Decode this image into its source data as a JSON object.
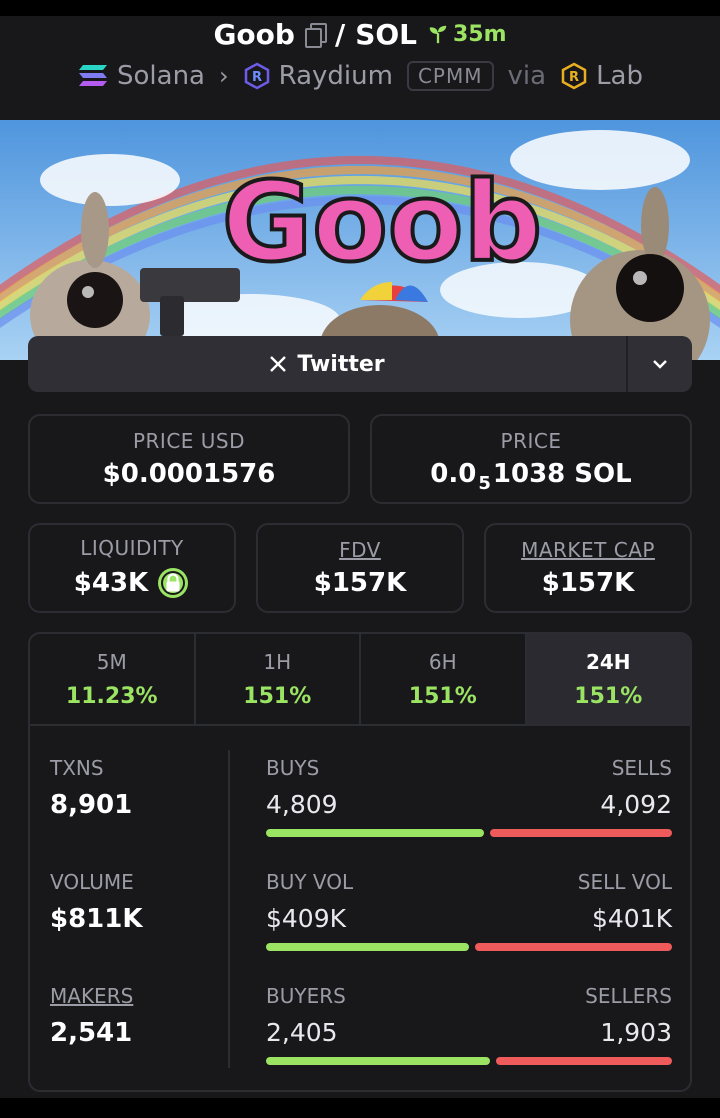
{
  "header": {
    "token": "Goob",
    "separator": "/",
    "quote": "SOL",
    "age": "35m",
    "chain": "Solana",
    "dex": "Raydium",
    "pool_type": "CPMM",
    "via": "via",
    "launchpad": "Lab"
  },
  "banner": {
    "text": "Goob"
  },
  "links": {
    "twitter_label": "Twitter"
  },
  "price": {
    "usd_label": "PRICE USD",
    "usd_value": "$0.0001576",
    "native_label": "PRICE",
    "native_prefix": "0.0",
    "native_zeros": "5",
    "native_digits": "1038 SOL"
  },
  "metrics": {
    "liquidity_label": "LIQUIDITY",
    "liquidity_value": "$43K",
    "fdv_label": "FDV",
    "fdv_value": "$157K",
    "mcap_label": "MARKET CAP",
    "mcap_value": "$157K"
  },
  "timeframes": [
    {
      "label": "5M",
      "change": "11.23%"
    },
    {
      "label": "1H",
      "change": "151%"
    },
    {
      "label": "6H",
      "change": "151%"
    },
    {
      "label": "24H",
      "change": "151%"
    }
  ],
  "stats": {
    "txns_label": "TXNS",
    "txns_value": "8,901",
    "buys_label": "BUYS",
    "buys_value": "4,809",
    "sells_label": "SELLS",
    "sells_value": "4,092",
    "volume_label": "VOLUME",
    "volume_value": "$811K",
    "buyvol_label": "BUY VOL",
    "buyvol_value": "$409K",
    "sellvol_label": "SELL VOL",
    "sellvol_value": "$401K",
    "makers_label": "MAKERS",
    "makers_value": "2,541",
    "buyers_label": "BUYERS",
    "buyers_value": "2,405",
    "sellers_label": "SELLERS",
    "sellers_value": "1,903"
  },
  "colors": {
    "positive": "#9be362",
    "negative": "#ef5b5b",
    "background": "#18181b"
  }
}
